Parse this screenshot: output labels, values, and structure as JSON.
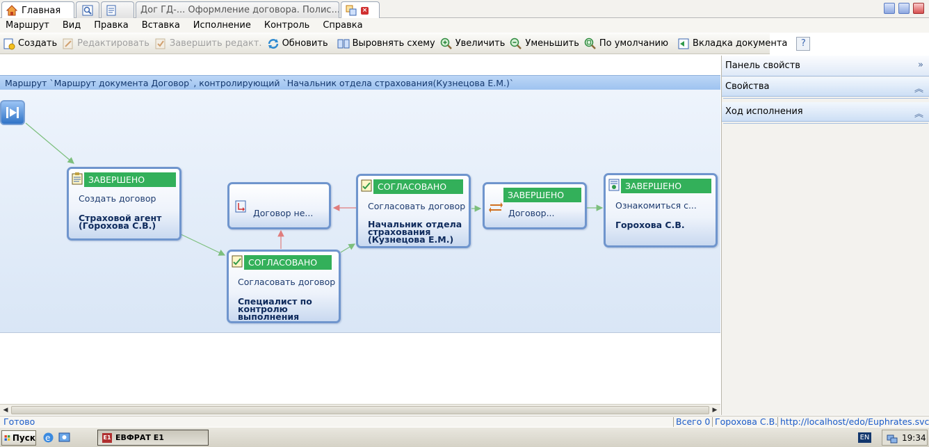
{
  "tabs": [
    {
      "label": "Главная",
      "icon": "home-icon",
      "active": true
    },
    {
      "label": "",
      "icon": "search-document-icon",
      "active": false
    },
    {
      "label": "",
      "icon": "document-list-icon",
      "active": false
    },
    {
      "label": "Дог ГД-...  Оформление договора. Полис...",
      "icon": "",
      "active": false
    },
    {
      "label": "",
      "icon": "route-icon",
      "active": false
    }
  ],
  "menu": [
    "Маршрут",
    "Вид",
    "Правка",
    "Вставка",
    "Исполнение",
    "Контроль",
    "Справка"
  ],
  "toolbar": {
    "create": "Создать",
    "edit": "Редактировать",
    "finish_edit": "Завершить редакт.",
    "refresh": "Обновить",
    "align": "Выровнять схему",
    "zoom_in": "Увеличить",
    "zoom_out": "Уменьшить",
    "default": "По умолчанию",
    "doc_tab": "Вкладка документа",
    "help": "?"
  },
  "breadcrumb": "Маршрут `Маршрут документа Договор`, контролирующий `Начальник отдела страхования(Кузнецова Е.М.)`",
  "nodes": {
    "n1": {
      "status": "ЗАВЕРШЕНО",
      "task": "Создать договор",
      "who": "Страховой агент (Горохова С.В.)"
    },
    "n2": {
      "status": "",
      "task": "Договор не...",
      "who": ""
    },
    "n3": {
      "status": "СОГЛАСОВАНО",
      "task": "Согласовать договор",
      "who": "Специалист по контролю выполнения"
    },
    "n4": {
      "status": "СОГЛАСОВАНО",
      "task": "Согласовать договор",
      "who": "Начальник отдела страхования (Кузнецова Е.М.)"
    },
    "n5": {
      "status": "ЗАВЕРШЕНО",
      "task": "Договор...",
      "who": ""
    },
    "n6": {
      "status": "ЗАВЕРШЕНО",
      "task": "Ознакомиться с...",
      "who": "Горохова С.В."
    }
  },
  "colors": {
    "status_green": "#33b05a",
    "node_border": "#6f95cd",
    "arrow_green": "#7dbf7d",
    "arrow_red": "#e07d7d"
  },
  "right_panel": {
    "title": "Панель свойств",
    "properties": "Свойства",
    "progress": "Ход исполнения"
  },
  "status": {
    "ready": "Готово",
    "total": "Всего 0",
    "user": "Горохова С.В.",
    "url": "http://localhost/edo/Euphrates.svc/"
  },
  "taskbar": {
    "start": "Пуск",
    "app": "ЕВФРАТ Е1",
    "lang": "EN",
    "time": "19:34"
  }
}
